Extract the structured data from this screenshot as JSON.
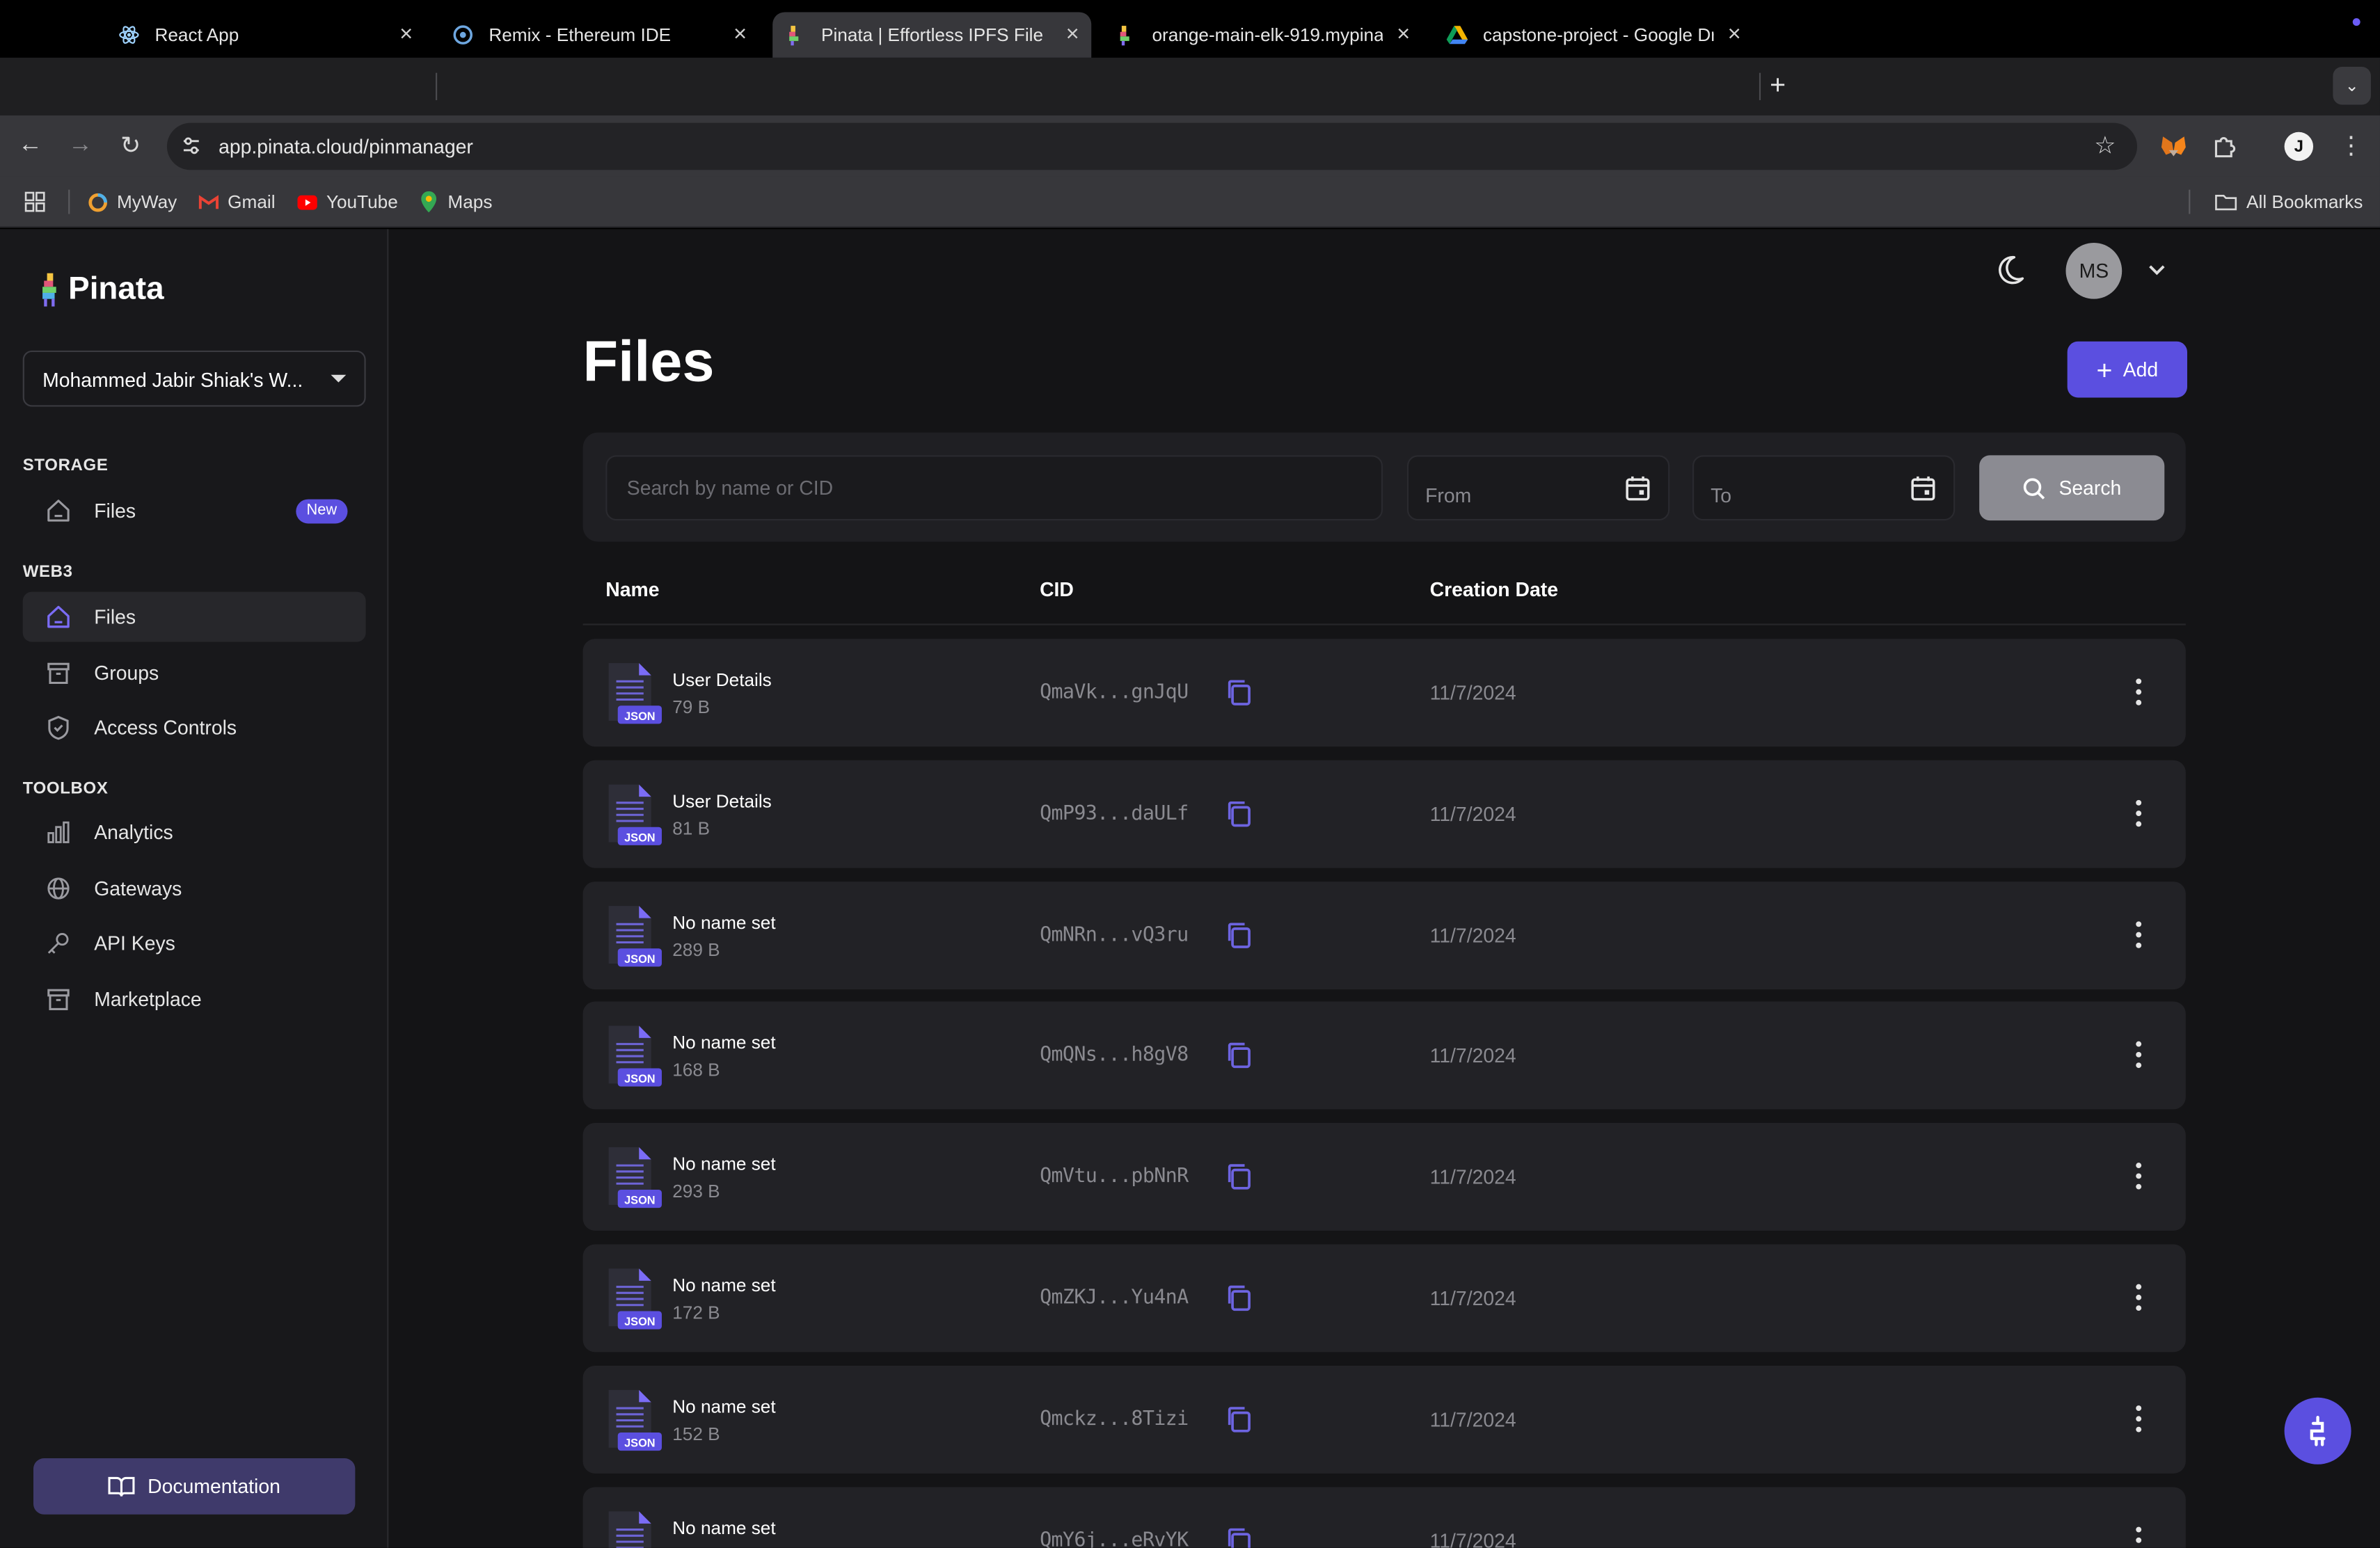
{
  "browser": {
    "tabs": [
      {
        "title": "React App"
      },
      {
        "title": "Remix - Ethereum IDE"
      },
      {
        "title": "Pinata | Effortless IPFS File M"
      },
      {
        "title": "orange-main-elk-919.mypina"
      },
      {
        "title": "capstone-project - Google Dr"
      }
    ],
    "url": "app.pinata.cloud/pinmanager",
    "bookmarks": [
      {
        "label": "MyWay"
      },
      {
        "label": "Gmail"
      },
      {
        "label": "YouTube"
      },
      {
        "label": "Maps"
      }
    ],
    "all_bookmarks": "All Bookmarks",
    "profile_initial": "J"
  },
  "sidebar": {
    "logo": "Pinata",
    "workspace": "Mohammed Jabir Shiak's W...",
    "sections": [
      {
        "title": "STORAGE",
        "items": [
          {
            "label": "Files",
            "badge": "New",
            "icon": "home-icon"
          }
        ]
      },
      {
        "title": "WEB3",
        "items": [
          {
            "label": "Files",
            "icon": "home-icon",
            "active": true
          },
          {
            "label": "Groups",
            "icon": "archive-icon"
          },
          {
            "label": "Access Controls",
            "icon": "shield-icon"
          }
        ]
      },
      {
        "title": "TOOLBOX",
        "items": [
          {
            "label": "Analytics",
            "icon": "bar-chart-icon"
          },
          {
            "label": "Gateways",
            "icon": "globe-icon"
          },
          {
            "label": "API Keys",
            "icon": "key-icon"
          },
          {
            "label": "Marketplace",
            "icon": "archive-icon"
          }
        ]
      }
    ],
    "documentation": "Documentation"
  },
  "header": {
    "avatar_initials": "MS"
  },
  "main": {
    "title": "Files",
    "add_label": "Add",
    "search_placeholder": "Search by name or CID",
    "from_label": "From",
    "to_label": "To",
    "search_button": "Search",
    "columns": {
      "name": "Name",
      "cid": "CID",
      "date": "Creation Date"
    },
    "file_badge": "JSON",
    "rows": [
      {
        "name": "User Details",
        "size": "79 B",
        "cid": "QmaVk...gnJqU",
        "date": "11/7/2024"
      },
      {
        "name": "User Details",
        "size": "81 B",
        "cid": "QmP93...daULf",
        "date": "11/7/2024"
      },
      {
        "name": "No name set",
        "size": "289 B",
        "cid": "QmNRn...vQ3ru",
        "date": "11/7/2024"
      },
      {
        "name": "No name set",
        "size": "168 B",
        "cid": "QmQNs...h8gV8",
        "date": "11/7/2024"
      },
      {
        "name": "No name set",
        "size": "293 B",
        "cid": "QmVtu...pbNnR",
        "date": "11/7/2024"
      },
      {
        "name": "No name set",
        "size": "172 B",
        "cid": "QmZKJ...Yu4nA",
        "date": "11/7/2024"
      },
      {
        "name": "No name set",
        "size": "152 B",
        "cid": "Qmckz...8Tizi",
        "date": "11/7/2024"
      },
      {
        "name": "No name set",
        "size": "",
        "cid": "QmY6j...eRvYK",
        "date": "11/7/2024"
      }
    ]
  },
  "colors": {
    "accent": "#5b4fe0",
    "background": "#141416",
    "sidebar": "#18181b",
    "row": "#222226"
  }
}
